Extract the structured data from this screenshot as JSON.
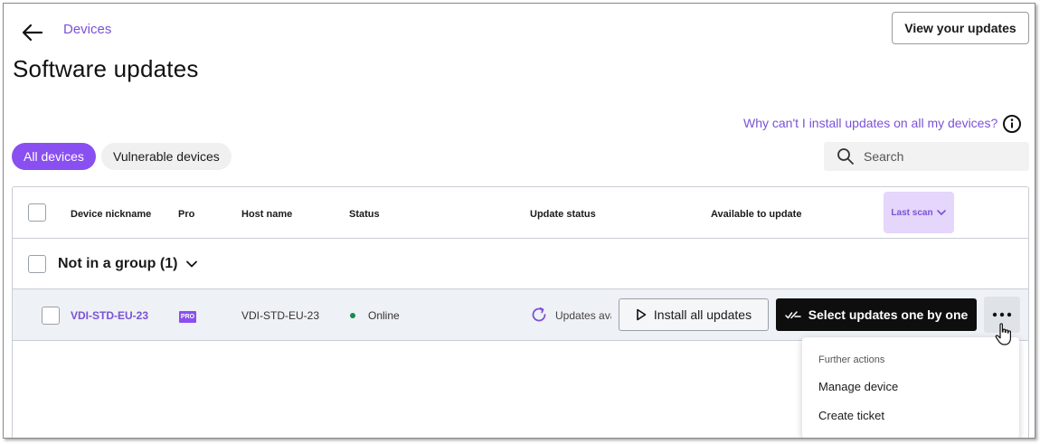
{
  "header": {
    "breadcrumb": "Devices",
    "title": "Software updates",
    "view_updates_label": "View your updates"
  },
  "help": {
    "why_link": "Why can't I install updates on all my devices?"
  },
  "filters": {
    "tabs": [
      {
        "label": "All devices",
        "active": true
      },
      {
        "label": "Vulnerable devices",
        "active": false
      }
    ]
  },
  "search": {
    "placeholder": "Search"
  },
  "table": {
    "columns": {
      "nickname": "Device nickname",
      "pro": "Pro",
      "host": "Host name",
      "status": "Status",
      "update_status": "Update status",
      "available": "Available to update",
      "last_scan": "Last scan"
    },
    "group": {
      "label": "Not in a group (1)"
    },
    "rows": [
      {
        "nickname": "VDI-STD-EU-23",
        "pro_badge": "PRO",
        "host": "VDI-STD-EU-23",
        "status": "Online",
        "update_status": "Updates available",
        "install_label": "Install all updates",
        "select_label": "Select updates one by one"
      }
    ]
  },
  "dropdown": {
    "heading": "Further actions",
    "items": [
      "Manage device",
      "Create ticket"
    ]
  },
  "colors": {
    "accent": "#8a4ff0",
    "link": "#7b52d6",
    "online": "#1a8a4a"
  }
}
